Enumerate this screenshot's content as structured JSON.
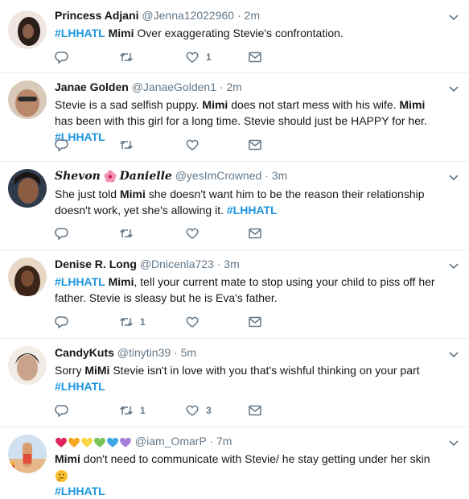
{
  "tweets": [
    {
      "name": "Princess Adjani",
      "handle": "@Jenna12022960",
      "time": "2m",
      "segments": [
        "#LHHATL",
        "Mimi",
        "Over exaggerating Stevie's confrontation."
      ],
      "counts": {
        "retweets": "",
        "likes": "1"
      },
      "avatar_color": "#2a1d1a"
    },
    {
      "name": "Janae Golden",
      "handle": "@JanaeGolden1",
      "time": "2m",
      "segments": [
        "Stevie is a sad selfish puppy.",
        "Mimi",
        "does not start mess with his wife.",
        "Mimi",
        "has",
        "been with this girl for a long time. Stevie should just be HAPPY for her.",
        "#LHHATL"
      ],
      "counts": {
        "retweets": "",
        "likes": ""
      },
      "avatar_color": "#b9886a"
    },
    {
      "name_part1": "Shevon",
      "name_part2": "Danielle",
      "handle": "@yesImCrowned",
      "time": "3m",
      "segments": [
        "She just told",
        "Mimi",
        "she doesn't want him to be the reason their relationship",
        "doesn't work, yet she's allowing it.",
        "#LHHATL"
      ],
      "counts": {
        "retweets": "",
        "likes": ""
      },
      "avatar_color": "#5b3a2a"
    },
    {
      "name": "Denise R. Long",
      "handle": "@Dnicenla723",
      "time": "3m",
      "segments": [
        "#LHHATL",
        "Mimi",
        ", tell your current mate to stop using your child to piss off her",
        "father. Stevie is sleasy but he is Eva's father."
      ],
      "counts": {
        "retweets": "1",
        "likes": ""
      },
      "avatar_color": "#3b2418"
    },
    {
      "name": "CandyKuts",
      "handle": "@tinytin39",
      "time": "5m",
      "segments": [
        "Sorry",
        "MiMi",
        "Stevie isn't in love with you that's wishful thinking on your part",
        "#LHHATL"
      ],
      "counts": {
        "retweets": "1",
        "likes": "3"
      },
      "avatar_color": "#c9a38a"
    },
    {
      "handle": "@iam_OmarP",
      "time": "7m",
      "segments": [
        "Mimi",
        "don't need to communicate with Stevie/ he stay getting under her skin",
        "#LHHATL"
      ],
      "avatar_color": "#8aa6c2"
    }
  ],
  "colors": {
    "text": "#14171a",
    "muted": "#657786",
    "hashtag": "#1b95e0",
    "divider": "#e6ecf0",
    "heart_emojis": [
      "#e0245e",
      "#f5a623",
      "#f9d548",
      "#79c35b",
      "#3ea6e6",
      "#a87fd8"
    ]
  },
  "icons": [
    "reply-icon",
    "retweet-icon",
    "like-icon",
    "message-icon",
    "caret-down-icon",
    "hibiscus-icon",
    "thinking-face-icon"
  ]
}
